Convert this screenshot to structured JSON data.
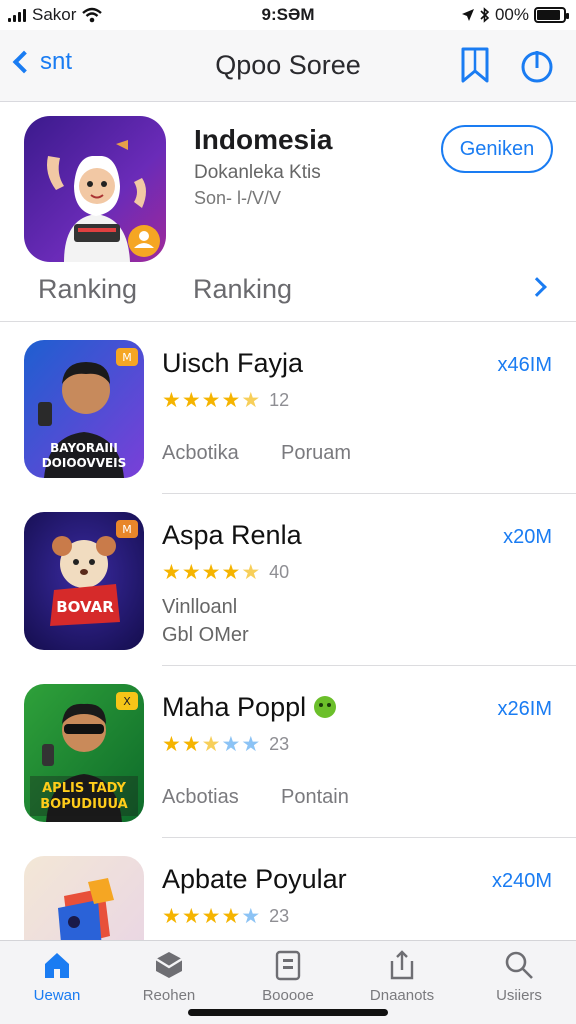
{
  "status_bar": {
    "carrier": "Sakor",
    "time": "9:SƏM",
    "battery": "00%",
    "battery_level": 0.9
  },
  "nav": {
    "back_label": "snt",
    "title": "Qpoo Soree",
    "bookmark_icon": "bookmark-icon",
    "share_icon": "share-icon"
  },
  "featured": {
    "title": "Indomesia",
    "subtitle": "Dokanleka Ktis",
    "subtitle2": "Son- l-/V/V",
    "get_label": "Geniken",
    "ranking_a": "Ranking",
    "ranking_b": "Ranking",
    "colors": {
      "icon_bg": "#5b2ca8",
      "accent": "#1a7cf2"
    }
  },
  "apps": [
    {
      "name": "Uisch Fayja",
      "size": "x46IM",
      "stars": 4,
      "half": true,
      "rating_count": "12",
      "tag1": "Acbotika",
      "tag2": "Poruam",
      "icon_text": [
        "BAYORAIII",
        "DOIOOVVEIS"
      ],
      "icon_badge": "M"
    },
    {
      "name": "Aspa Renla",
      "size": "x20M",
      "stars": 4,
      "half": true,
      "rating_count": "40",
      "line1": "Vinlloanl",
      "line2": "Gbl OMer",
      "icon_text": [
        "BOVAR"
      ],
      "icon_badge": "M"
    },
    {
      "name": "Maha Poppl",
      "size": "x26IM",
      "stars": 2,
      "half": true,
      "rating_count": "23",
      "tag1": "Acbotias",
      "tag2": "Pontain",
      "icon_text": [
        "APLIS TADY",
        "BOPUDIUUA"
      ],
      "icon_badge": "X"
    },
    {
      "name": "Apbate Poyular",
      "size": "x240M",
      "stars": 4,
      "half": false,
      "rating_count": "23"
    }
  ],
  "tabs": [
    {
      "label": "Uewan",
      "icon": "home-icon",
      "active": true
    },
    {
      "label": "Reohen",
      "icon": "apps-icon",
      "active": false
    },
    {
      "label": "Booooe",
      "icon": "document-icon",
      "active": false
    },
    {
      "label": "Dnaanots",
      "icon": "upload-icon",
      "active": false
    },
    {
      "label": "Usiiers",
      "icon": "search-icon",
      "active": false
    }
  ]
}
